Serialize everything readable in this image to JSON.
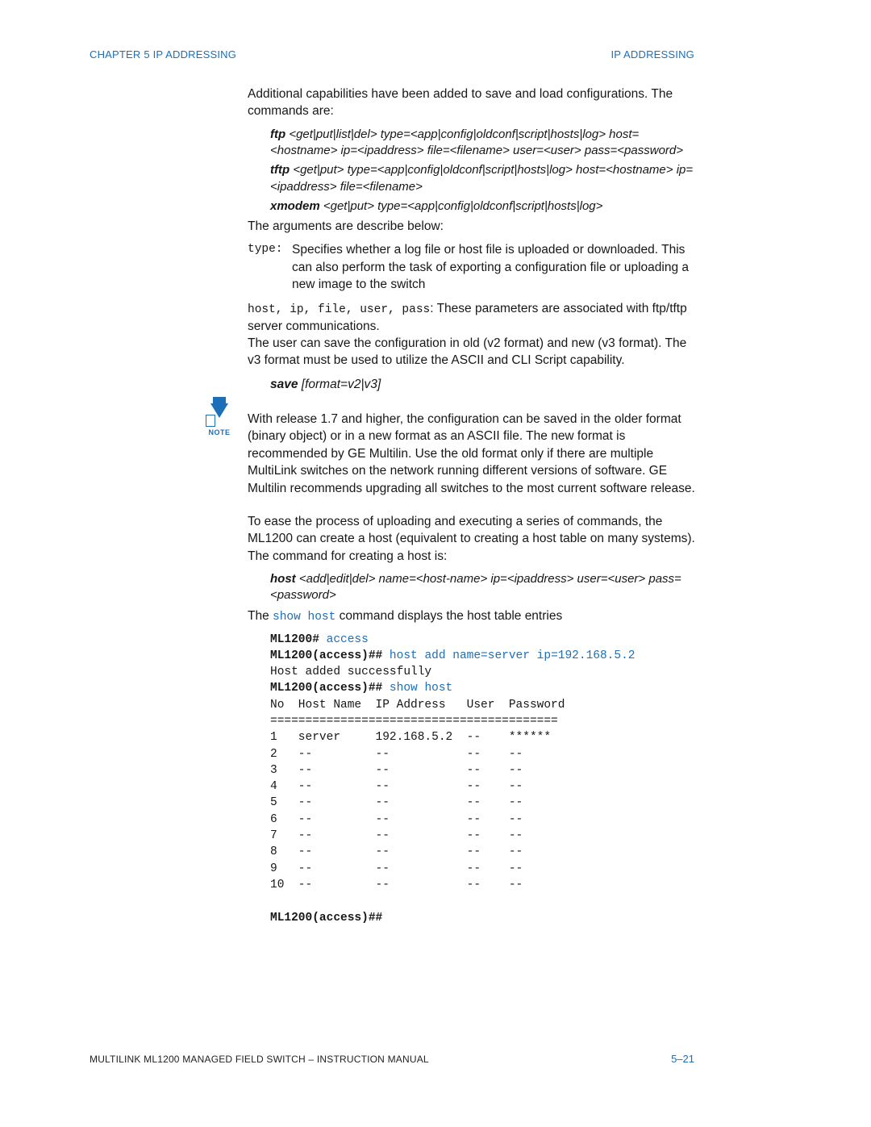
{
  "header": {
    "left": "CHAPTER 5  IP ADDRESSING",
    "right": "IP ADDRESSING"
  },
  "body": {
    "intro": "Additional capabilities have been added to save and load configurations. The commands are:",
    "syntax": {
      "ftp_kw": "ftp",
      "ftp_rest": " <get|put|list|del> type=<app|config|oldconf|script|hosts|log> host=<hostname> ip=<ipaddress> file=<filename> user=<user> pass=<password>",
      "tftp_kw": "tftp",
      "tftp_rest": " <get|put> type=<app|config|oldconf|script|hosts|log> host=<hostname> ip=<ipaddress> file=<filename>",
      "xmodem_kw": "xmodem",
      "xmodem_rest": " <get|put> type=<app|config|oldconf|script|hosts|log>"
    },
    "args_intro": "The arguments are describe below:",
    "arg_type_term": "type:",
    "arg_type_desc": "Specifies whether a log file or host file is uploaded or downloaded. This can also perform the task of exporting a configuration file or uploading a new image to the switch",
    "arg_hosts_terms": "host, ip, file, user, pass",
    "arg_hosts_rest": ": These parameters are associated with ftp/tftp server communications.",
    "save_para": "The user can save the configuration in old (v2 format) and new (v3 format). The v3 format must be used to utilize the ASCII and CLI Script capability.",
    "save_kw": "save",
    "save_rest": " [format=v2|v3]",
    "note_label": "NOTE",
    "note_para": "With release 1.7 and higher, the configuration can be saved in the older format (binary object) or in a new format as an ASCII file. The new format is recommended by GE Multilin. Use the old format only if there are multiple MultiLink switches on the network running different versions of software. GE Multilin recommends upgrading all switches to the most current software release.",
    "host_para": "To ease the process of uploading and executing a series of commands, the ML1200 can create a host (equivalent to creating a host table on many systems). The command for creating a host is:",
    "host_kw": "host",
    "host_rest": " <add|edit|del> name=<host-name> ip=<ipaddress> user=<user> pass=<password>",
    "show_pre": "The ",
    "show_cmd": "show host",
    "show_post": " command displays the host table entries"
  },
  "terminal": {
    "p1": "ML1200#",
    "c1": " access",
    "p2": "ML1200(access)##",
    "c2": " host add name=server ip=192.168.5.2",
    "r2": "Host added successfully",
    "p3": "ML1200(access)##",
    "c3": " show host",
    "table": "No  Host Name  IP Address   User  Password\n=========================================\n1   server     192.168.5.2  --    ******\n2   --         --           --    --\n3   --         --           --    --\n4   --         --           --    --\n5   --         --           --    --\n6   --         --           --    --\n7   --         --           --    --\n8   --         --           --    --\n9   --         --           --    --\n10  --         --           --    --",
    "p4": "ML1200(access)##"
  },
  "footer": {
    "left": "MULTILINK ML1200 MANAGED FIELD SWITCH – INSTRUCTION MANUAL",
    "right": "5–21"
  }
}
